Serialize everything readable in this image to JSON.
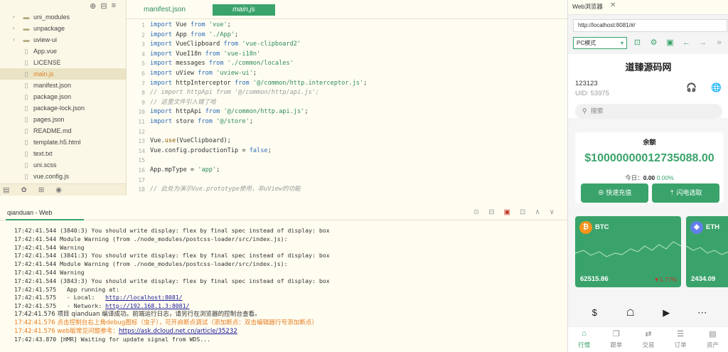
{
  "tree": {
    "toolbar_icons": [
      "⊕",
      "⊟",
      "≡"
    ],
    "items": [
      {
        "label": "uni_modules",
        "type": "folder"
      },
      {
        "label": "unpackage",
        "type": "folder"
      },
      {
        "label": "uview-ui",
        "type": "folder"
      },
      {
        "label": "App.vue",
        "type": "file"
      },
      {
        "label": "LICENSE",
        "type": "file"
      },
      {
        "label": "main.js",
        "type": "file"
      },
      {
        "label": "manifest.json",
        "type": "file"
      },
      {
        "label": "package.json",
        "type": "file"
      },
      {
        "label": "package-lock.json",
        "type": "file"
      },
      {
        "label": "pages.json",
        "type": "file"
      },
      {
        "label": "README.md",
        "type": "file"
      },
      {
        "label": "template.h5.html",
        "type": "file"
      },
      {
        "label": "text.txt",
        "type": "file"
      },
      {
        "label": "uni.scss",
        "type": "file"
      },
      {
        "label": "vue.config.js",
        "type": "file"
      }
    ]
  },
  "editor": {
    "tabs": [
      "manifest.json",
      "main.js"
    ],
    "lines": [
      {
        "n": "1",
        "parts": [
          [
            "kw",
            "import "
          ],
          [
            "id",
            "Vue "
          ],
          [
            "kw",
            "from "
          ],
          [
            "str",
            "'vue'"
          ],
          [
            "id",
            ";"
          ]
        ]
      },
      {
        "n": "2",
        "parts": [
          [
            "kw",
            "import "
          ],
          [
            "id",
            "App "
          ],
          [
            "kw",
            "from "
          ],
          [
            "str",
            "'./App'"
          ],
          [
            "id",
            ";"
          ]
        ]
      },
      {
        "n": "3",
        "parts": [
          [
            "kw",
            "import "
          ],
          [
            "id",
            "VueClipboard "
          ],
          [
            "kw",
            "from "
          ],
          [
            "str",
            "'vue-clipboard2'"
          ]
        ]
      },
      {
        "n": "4",
        "parts": [
          [
            "kw",
            "import "
          ],
          [
            "id",
            "VueI18n "
          ],
          [
            "kw",
            "from "
          ],
          [
            "str",
            "'vue-i18n'"
          ]
        ]
      },
      {
        "n": "5",
        "parts": [
          [
            "kw",
            "import "
          ],
          [
            "id",
            "messages "
          ],
          [
            "kw",
            "from "
          ],
          [
            "str",
            "'./common/locales'"
          ]
        ]
      },
      {
        "n": "6",
        "parts": [
          [
            "kw",
            "import "
          ],
          [
            "id",
            "uView "
          ],
          [
            "kw",
            "from "
          ],
          [
            "str",
            "'uview-ui'"
          ],
          [
            "id",
            ";"
          ]
        ]
      },
      {
        "n": "7",
        "parts": [
          [
            "kw",
            "import "
          ],
          [
            "id",
            "httpInterceptor "
          ],
          [
            "kw",
            "from "
          ],
          [
            "str",
            "'@/common/http.interceptor.js'"
          ],
          [
            "id",
            ";"
          ]
        ]
      },
      {
        "n": "8",
        "parts": [
          [
            "com",
            "// import httpApi from '@/common/http/api.js';"
          ]
        ]
      },
      {
        "n": "9",
        "parts": [
          [
            "com",
            "// 这里文件引入错了哈"
          ]
        ]
      },
      {
        "n": "10",
        "parts": [
          [
            "kw",
            "import "
          ],
          [
            "id",
            "httpApi "
          ],
          [
            "kw",
            "from "
          ],
          [
            "str",
            "'@/common/http.api.js'"
          ],
          [
            "id",
            ";"
          ]
        ]
      },
      {
        "n": "11",
        "parts": [
          [
            "kw",
            "import "
          ],
          [
            "id",
            "store "
          ],
          [
            "kw",
            "from "
          ],
          [
            "str",
            "'@/store'"
          ],
          [
            "id",
            ";"
          ]
        ]
      },
      {
        "n": "12",
        "parts": []
      },
      {
        "n": "13",
        "parts": [
          [
            "id",
            "Vue."
          ],
          [
            "fn",
            "use"
          ],
          [
            "id",
            "(VueClipboard);"
          ]
        ]
      },
      {
        "n": "14",
        "parts": [
          [
            "id",
            "Vue.config.productionTip = "
          ],
          [
            "kw",
            "false"
          ],
          [
            "id",
            ";"
          ]
        ]
      },
      {
        "n": "15",
        "parts": []
      },
      {
        "n": "16",
        "parts": [
          [
            "id",
            "App.mpType = "
          ],
          [
            "str",
            "'app'"
          ],
          [
            "id",
            ";"
          ]
        ]
      },
      {
        "n": "17",
        "parts": []
      },
      {
        "n": "18",
        "parts": [
          [
            "com",
            "// 此处为演示Vue.prototype使用，非uView的功能"
          ]
        ]
      }
    ]
  },
  "console": {
    "title": "qianduan - Web",
    "tools": [
      "⊙",
      "⊟",
      "▣",
      "⊡",
      "∧",
      "∨"
    ],
    "lines": [
      {
        "text": "17:42:41.544 (3840:3) You should write display: flex by final spec instead of display: box",
        "style": ""
      },
      {
        "text": "17:42:41.544 Module Warning (from ./node_modules/postcss-loader/src/index.js):",
        "style": ""
      },
      {
        "text": "17:42:41.544 Warning",
        "style": ""
      },
      {
        "text": "17:42:41.544 (3841:3) You should write display: flex by final spec instead of display: box",
        "style": ""
      },
      {
        "text": "17:42:41.544 Module Warning (from ./node_modules/postcss-loader/src/index.js):",
        "style": ""
      },
      {
        "text": "17:42:41.544 Warning",
        "style": ""
      },
      {
        "text": "17:42:41.544 (3843:3) You should write display: flex by final spec instead of display: box",
        "style": ""
      },
      {
        "text": "17:42:41.575   App running at:",
        "style": ""
      },
      {
        "prefix": "17:42:41.575   - Local:   ",
        "link": "http://localhost:8081/",
        "style": "link"
      },
      {
        "prefix": "17:42:41.575   - Network: ",
        "link": "http://192.168.1.3:8081/",
        "style": "link"
      },
      {
        "text": "17:42:41.576 项目 qianduan 编译成功。前端运行日志，请另行在浏览器的控制台查看。",
        "style": "cn"
      },
      {
        "text": "17:42:41.576 点击控制台右上角debug图标（虫子），可开启断点调试（添加断点：双击编辑器行号添加断点）",
        "style": "cn orange"
      },
      {
        "prefix": "17:42:41.576 web版常见问题参考：",
        "link": "https://ask.dcloud.net.cn/article/35232",
        "style": "link cnorange"
      },
      {
        "text": "17:42:43.870 [HMR] Waiting for update signal from WDS...",
        "style": ""
      }
    ]
  },
  "preview": {
    "tab_title": "Web浏览器",
    "url": "http://localhost:8081/#/",
    "mode": "PC模式",
    "tool_icons": [
      "⊡",
      "⚙",
      "▣",
      "←",
      "→",
      "»"
    ],
    "app_title": "道臻源码网",
    "user_name": "123123",
    "uid": "UID: 53975",
    "head_icons": [
      "🎧",
      "🌐"
    ],
    "search_placeholder": "搜索",
    "balance_label": "余额",
    "balance_value": "$10000000012735088.00",
    "today_label": "今日：",
    "today_value": "0.00",
    "today_pct": "0.00%",
    "btn_recharge": "快速充值",
    "btn_withdraw": "闪电选取",
    "coins": [
      {
        "name": "BTC",
        "price": "62515.86",
        "change": "▼1.77%",
        "badge": "₿",
        "badge_color": "#f7931a"
      },
      {
        "name": "ETH",
        "price": "2434.09",
        "change": "",
        "badge": "◆",
        "badge_color": "#627eea"
      }
    ],
    "shortcuts": [
      "$",
      "☖",
      "▶",
      "⋯"
    ],
    "nav": [
      {
        "label": "行情",
        "icon": "⌂",
        "active": true
      },
      {
        "label": "跟单",
        "icon": "❐",
        "active": false
      },
      {
        "label": "交易",
        "icon": "⇄",
        "active": false
      },
      {
        "label": "订单",
        "icon": "☰",
        "active": false
      },
      {
        "label": "资产",
        "icon": "▤",
        "active": false
      }
    ],
    "colors": {
      "accent": "#3aa36b",
      "down": "#c0392b"
    }
  }
}
